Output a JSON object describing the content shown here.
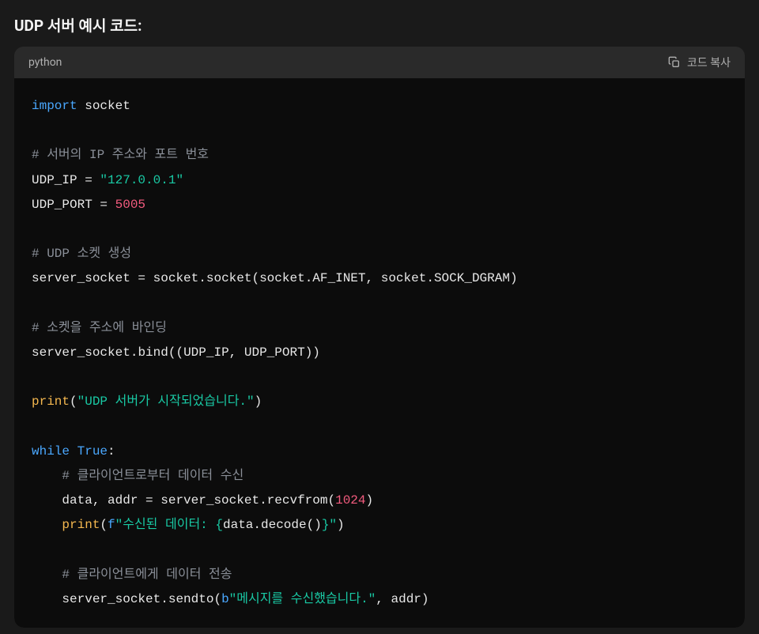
{
  "heading": "UDP 서버 예시 코드:",
  "codeblock": {
    "language": "python",
    "copy_label": "코드 복사"
  },
  "code": {
    "kw_import": "import",
    "mod_socket": "socket",
    "c1": "# 서버의 IP 주소와 포트 번호",
    "v_udp_ip": "UDP_IP",
    "eq": " = ",
    "s_ip": "\"127.0.0.1\"",
    "v_udp_port": "UDP_PORT",
    "n_port": "5005",
    "c2": "# UDP 소켓 생성",
    "v_ss": "server_socket",
    "dot": ".",
    "m_socket": "socket",
    "m_af": "AF_INET",
    "m_sd": "SOCK_DGRAM",
    "lp": "(",
    "rp": ")",
    "comma": ", ",
    "c3": "# 소켓을 주소에 바인딩",
    "m_bind": "bind",
    "f_print": "print",
    "s_started": "\"UDP 서버가 시작되었습니다.\"",
    "kw_while": "while",
    "kw_true": "True",
    "colon": ":",
    "c4": "# 클라이언트로부터 데이터 수신",
    "v_data": "data",
    "v_addr": "addr",
    "m_recvfrom": "recvfrom",
    "n_buf": "1024",
    "f_prefix": "f",
    "s_recv_a": "\"수신된 데이터: ",
    "lbrace": "{",
    "m_decode": "data.decode()",
    "rbrace": "}",
    "s_recv_b": "\"",
    "c5": "# 클라이언트에게 데이터 전송",
    "m_sendto": "sendto",
    "b_prefix": "b",
    "s_sent": "\"메시지를 수신했습니다.\""
  }
}
